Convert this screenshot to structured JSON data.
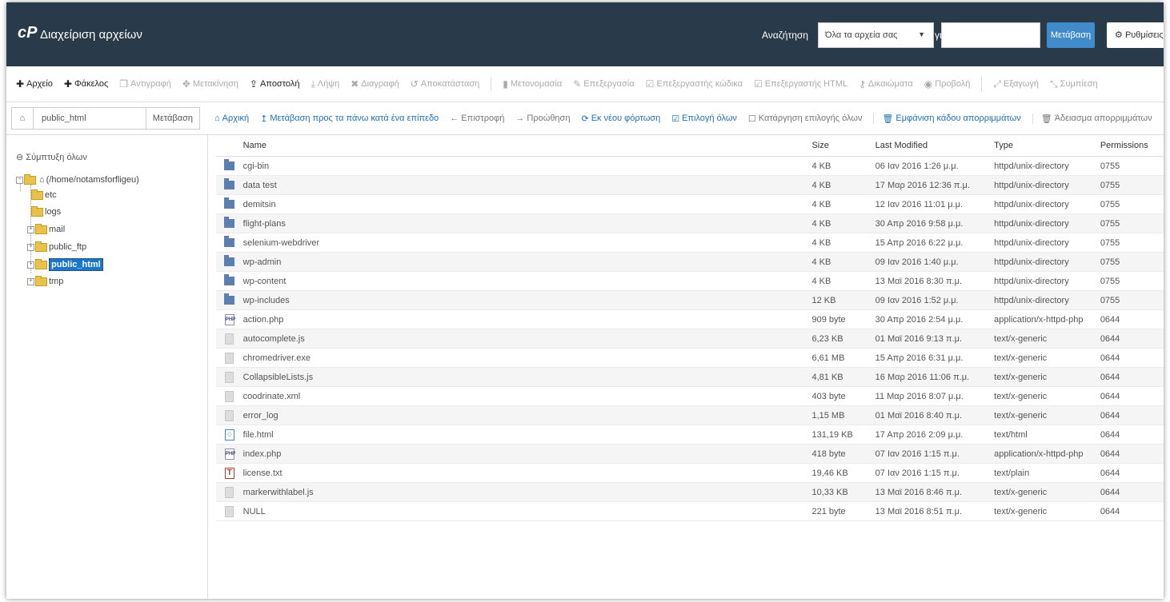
{
  "header": {
    "logo": "cP",
    "title": "Διαχείριση αρχείων",
    "search_label": "Αναζήτηση",
    "search_scope": "Όλα τα αρχεία σας",
    "for_label": "για",
    "search_value": "",
    "go_label": "Μετάβαση",
    "settings_label": "Ρυθμίσεις"
  },
  "toolbar": {
    "items": [
      {
        "icon": "plus-icon",
        "label": "Αρχείο"
      },
      {
        "icon": "plus-icon",
        "label": "Φάκελος"
      },
      {
        "icon": "copy-icon",
        "label": "Αντιγραφή"
      },
      {
        "icon": "move-icon",
        "label": "Μετακίνηση"
      },
      {
        "icon": "upload-icon",
        "label": "Αποστολή"
      },
      {
        "icon": "download-icon",
        "label": "Λήψη"
      },
      {
        "icon": "delete-icon",
        "label": "Διαγραφή"
      },
      {
        "icon": "restore-icon",
        "label": "Αποκατάσταση"
      },
      {
        "icon": "rename-icon",
        "label": "Μετονομασία"
      },
      {
        "icon": "edit-icon",
        "label": "Επεξεργασία"
      },
      {
        "icon": "code-edit-icon",
        "label": "Επεξεργαστής κώδικα"
      },
      {
        "icon": "html-edit-icon",
        "label": "Επεξεργαστής HTML"
      },
      {
        "icon": "key-icon",
        "label": "Δικαιώματα"
      },
      {
        "icon": "eye-icon",
        "label": "Προβολή"
      },
      {
        "icon": "extract-icon",
        "label": "Εξαγωγή"
      },
      {
        "icon": "compress-icon",
        "label": "Συμπίεση"
      }
    ]
  },
  "path": {
    "home_icon": "home-icon",
    "value": "public_html",
    "go_label": "Μετάβαση"
  },
  "nav": {
    "home": "Αρχική",
    "up_one": "Μετάβαση προς τα πάνω κατά ένα επίπεδο",
    "back": "Επιστροφή",
    "forward": "Προώθηση",
    "reload": "Εκ νέου φόρτωση",
    "select_all": "Επιλογή όλων",
    "unselect_all": "Κατάργηση επιλογής όλων",
    "show_trash": "Εμφάνιση κάδου απορριμμάτων",
    "empty_trash": "Άδειασμα απορριμμάτων"
  },
  "sidebar": {
    "collapse_all": "Σύμπτυξη όλων",
    "root": "(/home/notamsforfligeu)",
    "nodes": [
      "etc",
      "logs",
      "mail",
      "public_ftp",
      "public_html",
      "tmp"
    ]
  },
  "table": {
    "headers": {
      "name": "Name",
      "size": "Size",
      "modified": "Last Modified",
      "type": "Type",
      "perms": "Permissions"
    },
    "rows": [
      {
        "icon": "folder",
        "name": "cgi-bin",
        "size": "4 KB",
        "modified": "06 Ιαν 2016 1:26 μ.μ.",
        "type": "httpd/unix-directory",
        "perms": "0755"
      },
      {
        "icon": "folder",
        "name": "data test",
        "size": "4 KB",
        "modified": "17 Μαρ 2016 12:36 π.μ.",
        "type": "httpd/unix-directory",
        "perms": "0755"
      },
      {
        "icon": "folder",
        "name": "demitsin",
        "size": "4 KB",
        "modified": "12 Ιαν 2016 11:01 μ.μ.",
        "type": "httpd/unix-directory",
        "perms": "0755"
      },
      {
        "icon": "folder",
        "name": "flight-plans",
        "size": "4 KB",
        "modified": "30 Απρ 2016 9:58 μ.μ.",
        "type": "httpd/unix-directory",
        "perms": "0755"
      },
      {
        "icon": "folder",
        "name": "selenium-webdriver",
        "size": "4 KB",
        "modified": "15 Απρ 2016 6:22 μ.μ.",
        "type": "httpd/unix-directory",
        "perms": "0755"
      },
      {
        "icon": "folder",
        "name": "wp-admin",
        "size": "4 KB",
        "modified": "09 Ιαν 2016 1:40 μ.μ.",
        "type": "httpd/unix-directory",
        "perms": "0755"
      },
      {
        "icon": "folder",
        "name": "wp-content",
        "size": "4 KB",
        "modified": "13 Μαϊ 2016 8:30 π.μ.",
        "type": "httpd/unix-directory",
        "perms": "0755"
      },
      {
        "icon": "folder",
        "name": "wp-includes",
        "size": "12 KB",
        "modified": "09 Ιαν 2016 1:52 μ.μ.",
        "type": "httpd/unix-directory",
        "perms": "0755"
      },
      {
        "icon": "php",
        "name": "action.php",
        "size": "909 byte",
        "modified": "30 Απρ 2016 2:54 μ.μ.",
        "type": "application/x-httpd-php",
        "perms": "0644"
      },
      {
        "icon": "file",
        "name": "autocomplete.js",
        "size": "6,23 KB",
        "modified": "01 Μαϊ 2016 9:13 π.μ.",
        "type": "text/x-generic",
        "perms": "0644"
      },
      {
        "icon": "file",
        "name": "chromedriver.exe",
        "size": "6,61 MB",
        "modified": "15 Απρ 2016 6:31 μ.μ.",
        "type": "text/x-generic",
        "perms": "0644"
      },
      {
        "icon": "file",
        "name": "CollapsibleLists.js",
        "size": "4,81 KB",
        "modified": "16 Μαρ 2016 11:06 π.μ.",
        "type": "text/x-generic",
        "perms": "0644"
      },
      {
        "icon": "file",
        "name": "coodrinate.xml",
        "size": "403 byte",
        "modified": "11 Μαρ 2016 8:07 μ.μ.",
        "type": "text/x-generic",
        "perms": "0644"
      },
      {
        "icon": "file",
        "name": "error_log",
        "size": "1,15 MB",
        "modified": "01 Μαϊ 2016 8:40 π.μ.",
        "type": "text/x-generic",
        "perms": "0644"
      },
      {
        "icon": "html",
        "name": "file.html",
        "size": "131,19 KB",
        "modified": "17 Απρ 2016 2:09 μ.μ.",
        "type": "text/html",
        "perms": "0644"
      },
      {
        "icon": "php",
        "name": "index.php",
        "size": "418 byte",
        "modified": "07 Ιαν 2016 1:15 π.μ.",
        "type": "application/x-httpd-php",
        "perms": "0644"
      },
      {
        "icon": "txt",
        "name": "license.txt",
        "size": "19,46 KB",
        "modified": "07 Ιαν 2016 1:15 π.μ.",
        "type": "text/plain",
        "perms": "0644"
      },
      {
        "icon": "file",
        "name": "markerwithlabel.js",
        "size": "10,33 KB",
        "modified": "13 Μαϊ 2016 8:46 π.μ.",
        "type": "text/x-generic",
        "perms": "0644"
      },
      {
        "icon": "file",
        "name": "NULL",
        "size": "221 byte",
        "modified": "13 Μαϊ 2016 8:51 π.μ.",
        "type": "text/x-generic",
        "perms": "0644"
      }
    ]
  },
  "colors": {
    "header_bg": "#293a4a",
    "accent": "#428bca",
    "link": "#1e6fbd",
    "selected": "#1a75ce"
  }
}
